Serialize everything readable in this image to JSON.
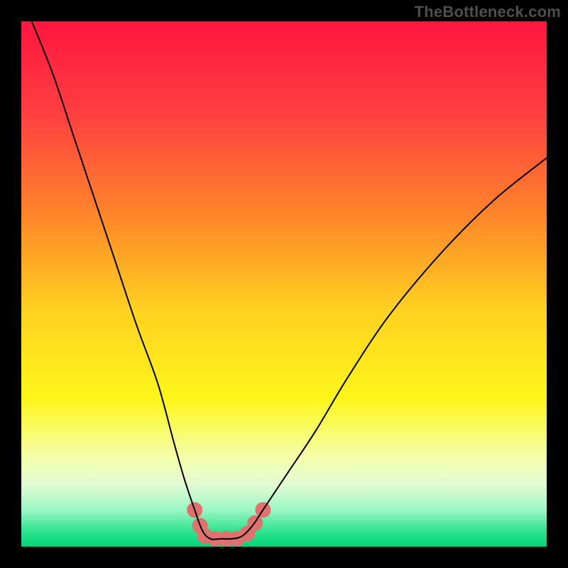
{
  "watermark": "TheBottleneck.com",
  "chart_data": {
    "type": "line",
    "title": "",
    "xlabel": "",
    "ylabel": "",
    "xlim": [
      0,
      100
    ],
    "ylim": [
      0,
      100
    ],
    "grid": false,
    "legend": false,
    "background": {
      "type": "vertical-gradient",
      "stops": [
        {
          "offset": 0.0,
          "color": "#ff163f"
        },
        {
          "offset": 0.18,
          "color": "#ff4040"
        },
        {
          "offset": 0.38,
          "color": "#ff8a28"
        },
        {
          "offset": 0.55,
          "color": "#ffd21f"
        },
        {
          "offset": 0.72,
          "color": "#fdf61a"
        },
        {
          "offset": 0.82,
          "color": "#f6ffa0"
        },
        {
          "offset": 0.88,
          "color": "#e4fcd4"
        },
        {
          "offset": 0.93,
          "color": "#9bf7c4"
        },
        {
          "offset": 0.97,
          "color": "#30e38d"
        },
        {
          "offset": 1.0,
          "color": "#00d578"
        }
      ]
    },
    "series": [
      {
        "name": "bottleneck-curve",
        "stroke": "#000000",
        "stroke_width": 2,
        "x": [
          2,
          6,
          10,
          14,
          18,
          22,
          26,
          29,
          31,
          33,
          34.5,
          36,
          38,
          40,
          42,
          44,
          46,
          50,
          56,
          62,
          70,
          80,
          90,
          100
        ],
        "y": [
          100,
          90,
          78,
          66,
          54,
          42,
          31,
          20,
          13,
          7,
          3,
          1.5,
          1.5,
          1.5,
          2,
          4,
          7,
          13,
          22,
          32,
          44,
          56,
          66,
          74
        ]
      },
      {
        "name": "highlight-markers",
        "type": "scatter",
        "marker_color": "#e1716f",
        "marker_radius": 11,
        "x": [
          33,
          34,
          35,
          37,
          39,
          41,
          43,
          44.5,
          46
        ],
        "y": [
          7,
          4,
          2,
          1.5,
          1.5,
          1.5,
          2.5,
          4.5,
          7
        ]
      }
    ]
  }
}
